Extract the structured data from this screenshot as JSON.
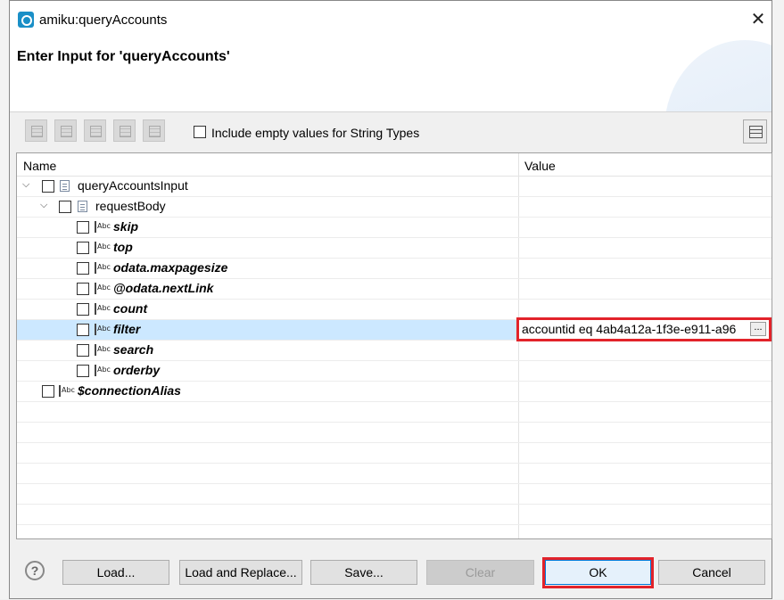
{
  "window": {
    "title": "amiku:queryAccounts",
    "close_glyph": "✕"
  },
  "header": {
    "title": "Enter Input for 'queryAccounts'"
  },
  "toolbar": {
    "include_empty_label": "Include empty values for String Types"
  },
  "table": {
    "columns": [
      "Name",
      "Value"
    ],
    "rows": [
      {
        "label": "queryAccountsInput",
        "value": ""
      },
      {
        "label": "requestBody",
        "value": ""
      },
      {
        "label": "skip",
        "value": ""
      },
      {
        "label": "top",
        "value": ""
      },
      {
        "label": "odata.maxpagesize",
        "value": ""
      },
      {
        "label": "@odata.nextLink",
        "value": ""
      },
      {
        "label": "count",
        "value": ""
      },
      {
        "label": "filter",
        "value": "accountid eq 4ab4a12a-1f3e-e911-a96"
      },
      {
        "label": "search",
        "value": ""
      },
      {
        "label": "orderby",
        "value": ""
      },
      {
        "label": "$connectionAlias",
        "value": ""
      }
    ],
    "abc_icon_text": "Abc",
    "ellipsis": "..."
  },
  "footer": {
    "help": "?",
    "load": "Load...",
    "load_replace": "Load and Replace...",
    "save": "Save...",
    "clear": "Clear",
    "ok": "OK",
    "cancel": "Cancel"
  }
}
